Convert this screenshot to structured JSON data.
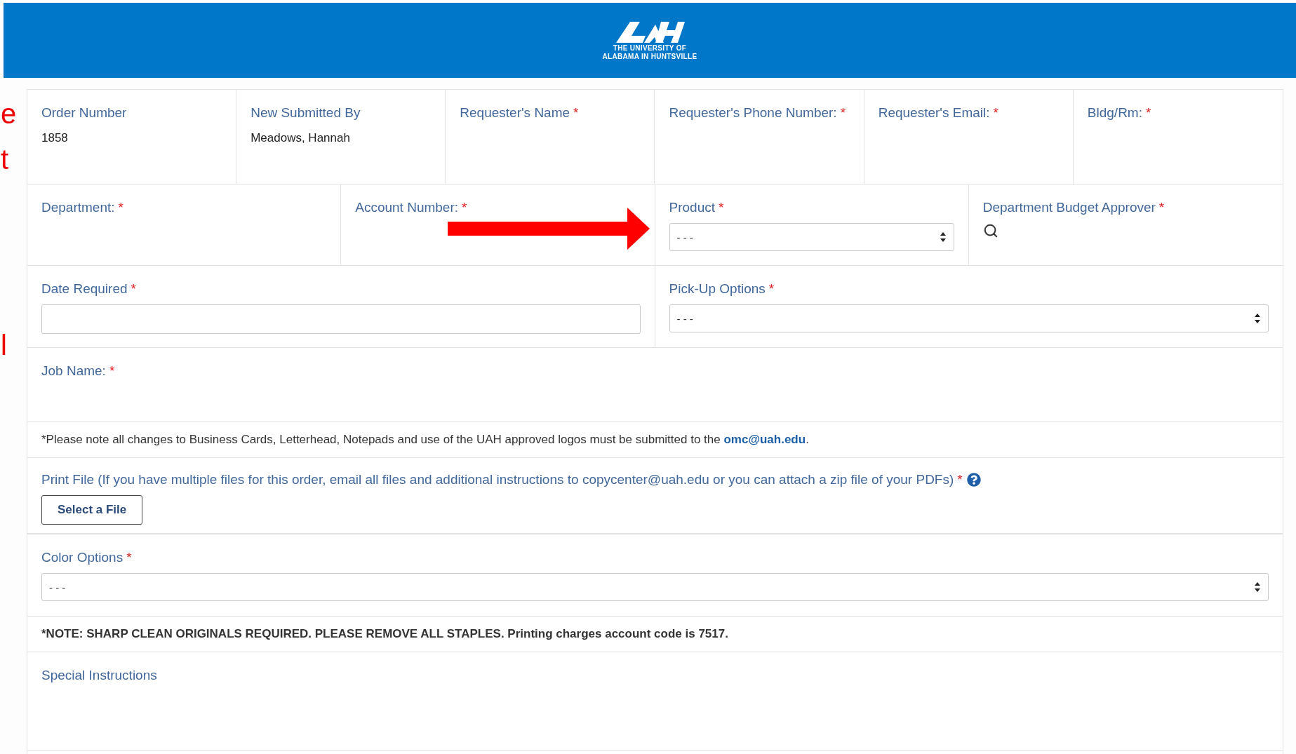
{
  "header": {
    "logo_line_1": "THE UNIVERSITY OF",
    "logo_line_2": "ALABAMA IN HUNTSVILLE"
  },
  "edge_fragments": [
    {
      "text": "e"
    },
    {
      "text": "t"
    },
    {
      "text": "l"
    }
  ],
  "sections": [
    {
      "kind": "grid",
      "cells": [
        {
          "kind": "text",
          "label": "Order Number",
          "value": "1858"
        },
        {
          "kind": "text",
          "label": "New Submitted By",
          "value": "Meadows, Hannah"
        },
        {
          "kind": "text",
          "label": "Requester's Name",
          "mark": "*"
        },
        {
          "kind": "text",
          "label": "Requester's Phone Number:",
          "mark": "*"
        },
        {
          "kind": "text",
          "label": "Requester's Email:",
          "mark": "*"
        },
        {
          "kind": "text",
          "label": "Bldg/Rm:",
          "mark": "*"
        }
      ]
    },
    {
      "kind": "grid",
      "cells": [
        {
          "kind": "text",
          "label": "Department:",
          "mark": "*"
        },
        {
          "kind": "text",
          "label": "Account Number:",
          "mark": "*"
        },
        {
          "kind": "select",
          "label": "Product",
          "mark": "*",
          "value": "- - -"
        },
        {
          "kind": "lookup",
          "label": "Department Budget Approver",
          "mark": "*"
        }
      ]
    },
    {
      "kind": "grid",
      "cells": [
        {
          "kind": "input",
          "label": "Date Required",
          "mark": "*"
        },
        {
          "kind": "select",
          "label": "Pick-Up Options",
          "mark": "*",
          "value": "- - -"
        }
      ]
    },
    {
      "kind": "grid",
      "cells": [
        {
          "kind": "text",
          "label": "Job Name:",
          "mark": "*"
        }
      ]
    },
    {
      "kind": "note",
      "text": "*Please note all changes to Business Cards, Letterhead, Notepads and use of the UAH approved logos must be submitted to the ",
      "link": "omc@uah.edu",
      "after": "."
    },
    {
      "kind": "file",
      "label": "Print File (If you have multiple files for this order, email all files and additional instructions to copycenter@uah.edu or you can attach a zip file of your PDFs)",
      "mark": "*",
      "button": "Select a File"
    },
    {
      "kind": "grid",
      "cells": [
        {
          "kind": "select",
          "label": "Color Options",
          "mark": "*",
          "value": "- - -"
        }
      ]
    },
    {
      "kind": "bold_note",
      "text": "*NOTE: SHARP CLEAN ORIGINALS REQUIRED. PLEASE REMOVE ALL STAPLES. Printing charges account code is 7517."
    },
    {
      "kind": "grid",
      "cells": [
        {
          "kind": "text",
          "label": "Special Instructions"
        }
      ]
    }
  ]
}
